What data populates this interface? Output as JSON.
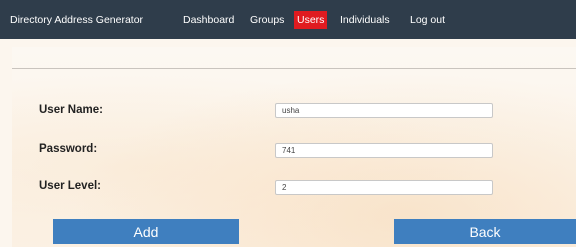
{
  "nav": {
    "brand": "Directory Address Generator",
    "items": [
      {
        "label": "Dashboard"
      },
      {
        "label": "Groups"
      },
      {
        "label": "Users",
        "active": true
      },
      {
        "label": "Individuals"
      },
      {
        "label": "Log out"
      }
    ],
    "active_color": "#e01b20",
    "bar_color": "#2f3d4b"
  },
  "form": {
    "username_label": "User Name:",
    "username_value": "usha",
    "password_label": "Password:",
    "password_value": "741",
    "userlevel_label": "User Level:",
    "userlevel_value": "2"
  },
  "buttons": {
    "add_label": "Add",
    "back_label": "Back",
    "color": "#3f7fbf"
  }
}
